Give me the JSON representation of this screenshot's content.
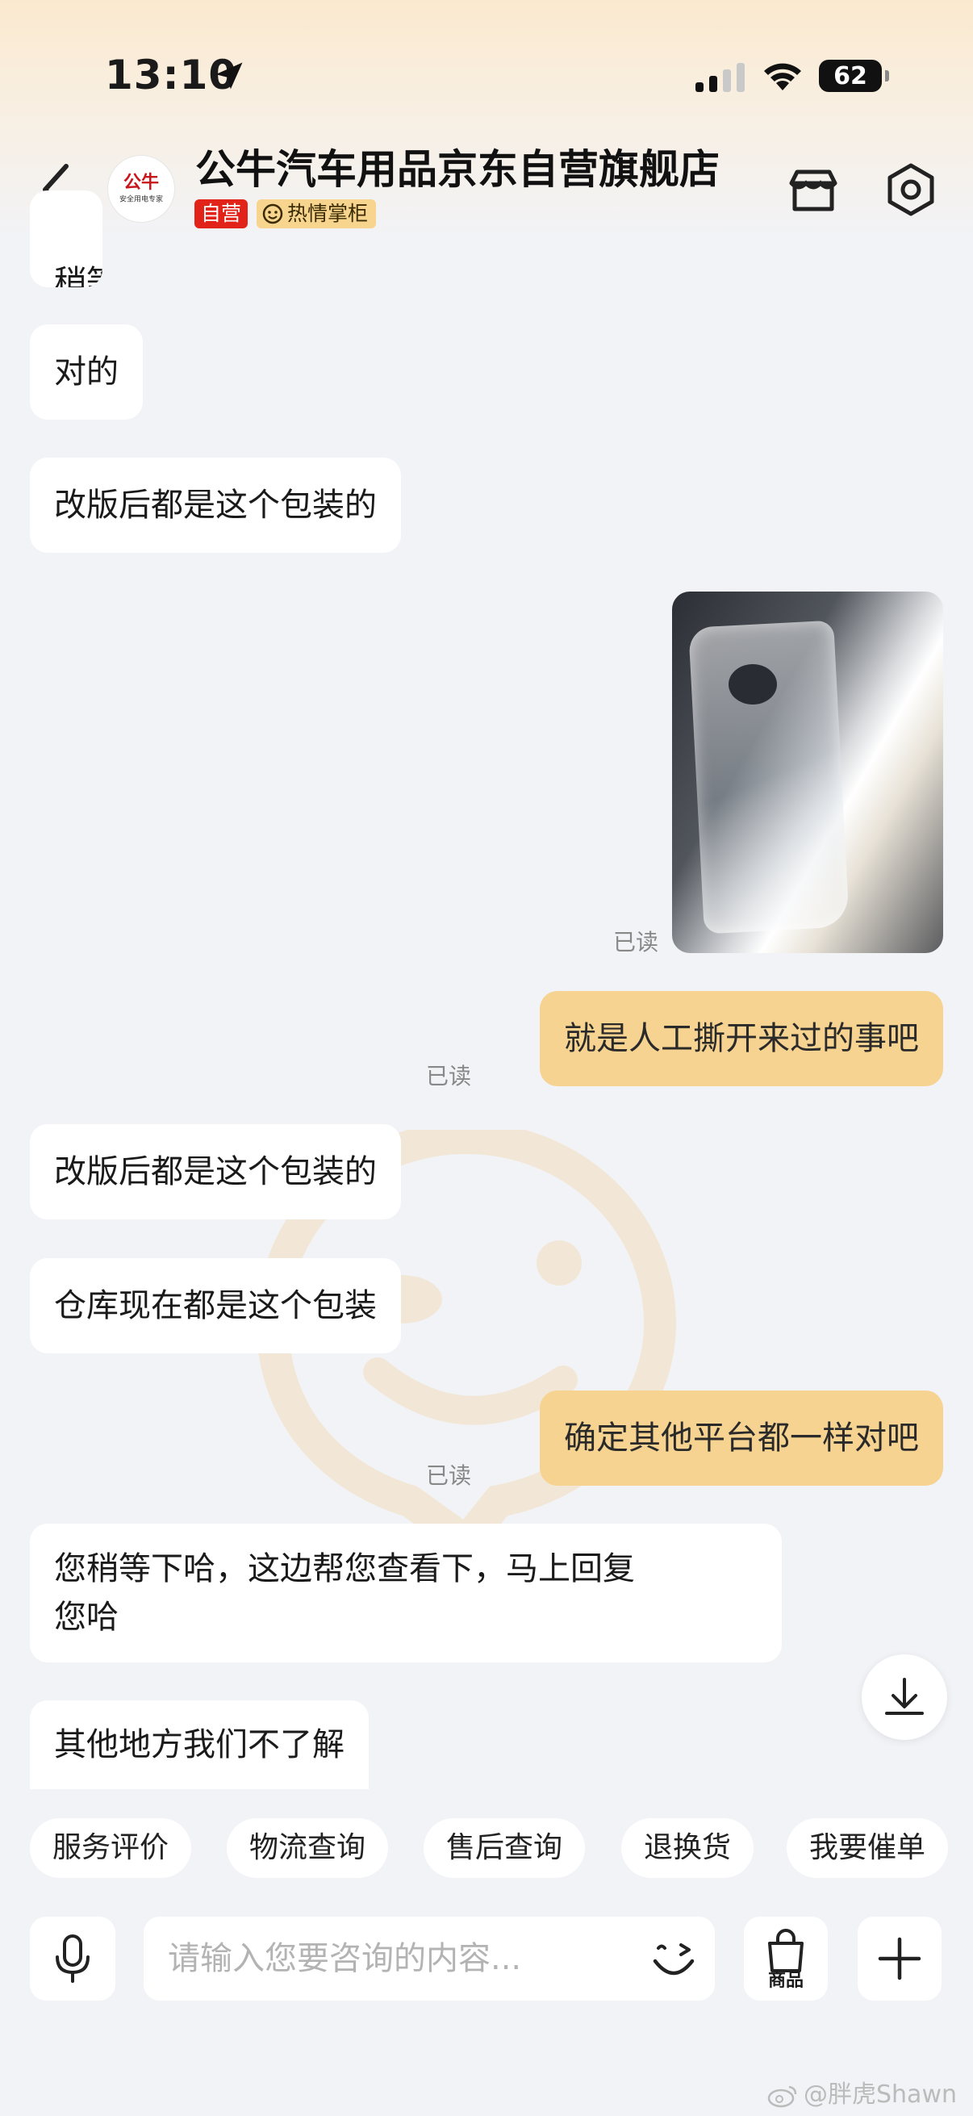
{
  "status_bar": {
    "time": "13:10",
    "battery": "62"
  },
  "header": {
    "title": "公牛汽车用品京东自营旗舰店",
    "avatar_text": "公牛",
    "avatar_subtext": "安全用电专家",
    "badge_self": "自营",
    "badge_host": "热情掌柜"
  },
  "messages": [
    {
      "side": "in",
      "text": "稍等"
    },
    {
      "side": "in",
      "text": "对的"
    },
    {
      "side": "in",
      "text": "改版后都是这个包装的"
    },
    {
      "side": "out",
      "type": "image",
      "read": "已读"
    },
    {
      "side": "out",
      "text": "就是人工撕开来过的事吧",
      "read": "已读"
    },
    {
      "side": "in",
      "text": "改版后都是这个包装的"
    },
    {
      "side": "in",
      "text": "仓库现在都是这个包装"
    },
    {
      "side": "out",
      "text": "确定其他平台都一样对吧",
      "read": "已读"
    },
    {
      "side": "in",
      "text": "您稍等下哈，这边帮您查看下，马上回复",
      "text2": "您哈"
    },
    {
      "side": "in",
      "text": "其他地方我们不了解"
    }
  ],
  "quick_replies": [
    "服务评价",
    "物流查询",
    "售后查询",
    "退换货",
    "我要催单"
  ],
  "input": {
    "placeholder": "请输入您要咨询的内容...",
    "value": ""
  },
  "goods_label": "商品",
  "watermark": {
    "handle": "@胖虎Shawn"
  },
  "colors": {
    "outgoing_bubble": "#f6d390",
    "incoming_bubble": "#ffffff",
    "badge_self": "#e2231a",
    "badge_host": "#f7d58e"
  },
  "icons": [
    "location-arrow-icon",
    "signal-icon",
    "wifi-icon",
    "back-chevron-icon",
    "store-icon",
    "settings-icon",
    "arrow-down-icon",
    "microphone-icon",
    "emoji-icon",
    "shopping-bag-icon",
    "plus-icon",
    "weibo-icon"
  ]
}
